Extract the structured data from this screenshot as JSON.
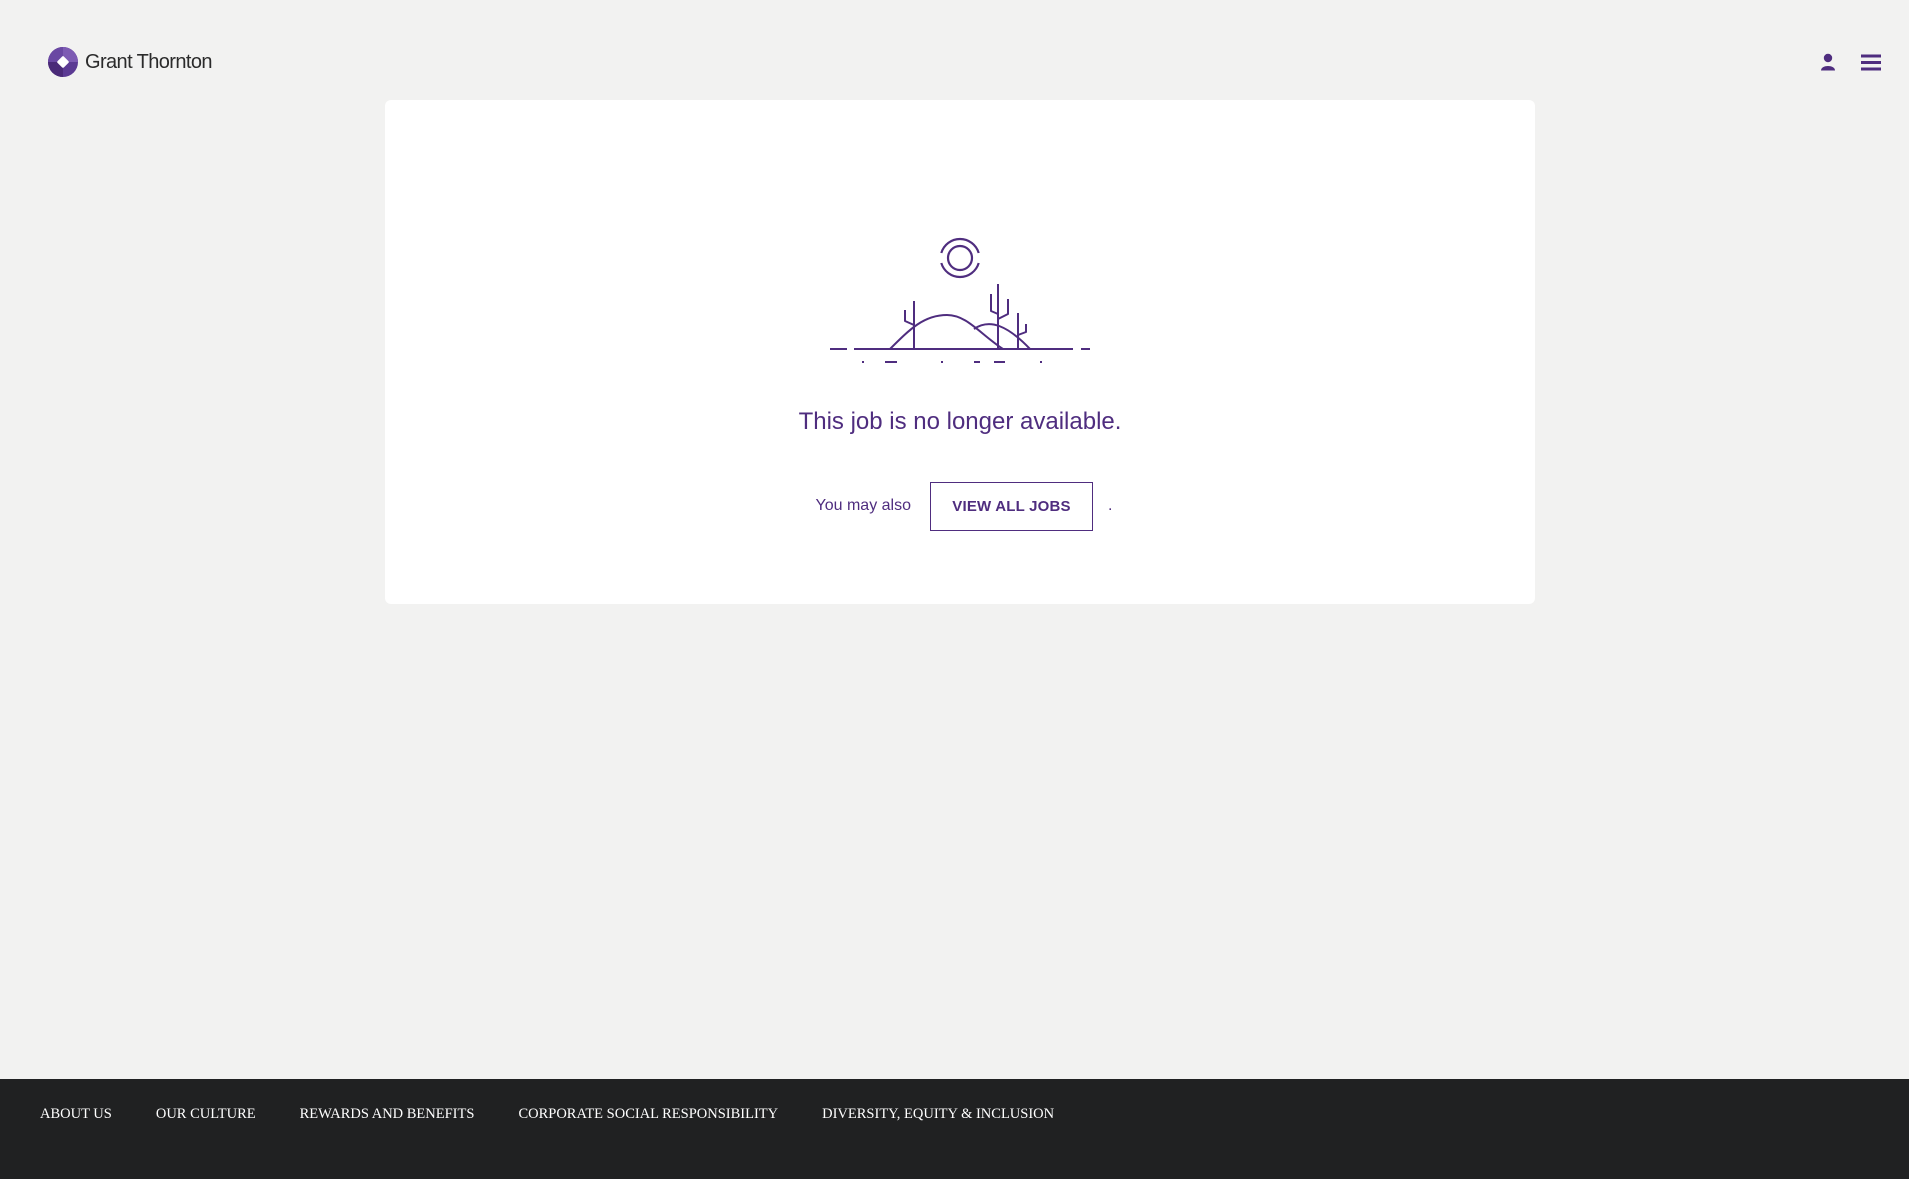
{
  "header": {
    "logo_text": "Grant Thornton",
    "icons": {
      "logo": "grant-thornton-logo-icon",
      "account": "user-icon",
      "menu": "hamburger-menu-icon"
    }
  },
  "main": {
    "illustration_icon": "desert-landscape-icon",
    "message": "This job is no longer available.",
    "prompt_text": "You may also",
    "view_all_jobs_label": "VIEW ALL JOBS",
    "trailing_period": "."
  },
  "footer": {
    "links": [
      "ABOUT US",
      "OUR CULTURE",
      "REWARDS AND BENEFITS",
      "CORPORATE SOCIAL RESPONSIBILITY",
      "DIVERSITY, EQUITY & INCLUSION"
    ]
  },
  "colors": {
    "brand_purple": "#4f2d7f",
    "page_background": "#f2f2f1",
    "card_background": "#ffffff",
    "footer_background": "#202122",
    "footer_text": "#ffffff"
  }
}
